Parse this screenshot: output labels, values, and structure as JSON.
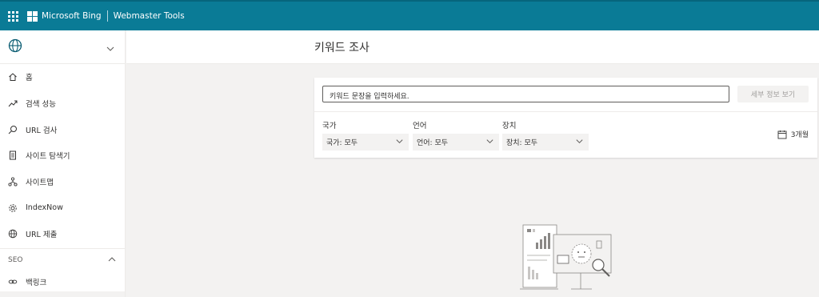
{
  "topbar": {
    "brand": "Microsoft Bing",
    "product": "Webmaster Tools",
    "icons": [
      "app-launcher-icon",
      "microsoft-logo-icon"
    ]
  },
  "sidebar": {
    "site_picker": {
      "icon": "globe-icon",
      "expand_icon": "chevron-down-icon"
    },
    "items": [
      {
        "label": "홈",
        "icon": "home-icon"
      },
      {
        "label": "검색 성능",
        "icon": "trend-up-icon"
      },
      {
        "label": "URL 검사",
        "icon": "search-icon"
      },
      {
        "label": "사이트 탐색기",
        "icon": "document-icon"
      },
      {
        "label": "사이트맵",
        "icon": "sitemap-icon"
      },
      {
        "label": "IndexNow",
        "icon": "gear-icon"
      },
      {
        "label": "URL 제출",
        "icon": "globe-icon"
      }
    ],
    "group": {
      "label": "SEO",
      "icon": "chevron-up-icon"
    },
    "seo_items": [
      {
        "label": "백링크",
        "icon": "link-icon"
      }
    ]
  },
  "main": {
    "title": "키워드 조사",
    "search": {
      "placeholder": "키워드 문장을 입력하세요.",
      "value": ""
    },
    "detail_button": "세부 정보 보기",
    "filters": [
      {
        "label": "국가",
        "value": "국가: 모두"
      },
      {
        "label": "언어",
        "value": "언어: 모두"
      },
      {
        "label": "장치",
        "value": "장치: 모두"
      }
    ],
    "period": {
      "label": "3개월",
      "icon": "calendar-icon"
    },
    "empty_state_icon": "empty-state-illustration-icon"
  },
  "colors": {
    "topbar": "#0a7b96",
    "panel": "#ffffff",
    "background": "#f3f2f1",
    "disabled_text": "#a19f9d"
  }
}
